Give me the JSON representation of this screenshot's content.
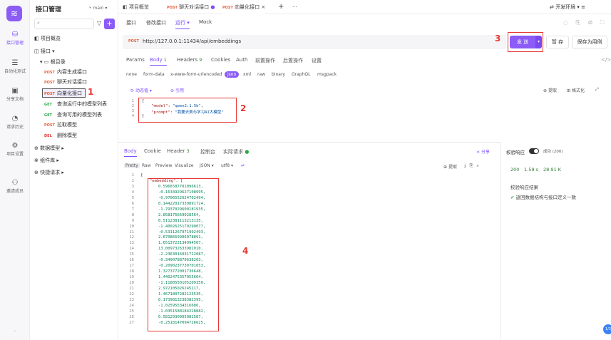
{
  "rail": {
    "items": [
      {
        "label": "接口管理",
        "icon": "api-icon"
      },
      {
        "label": "自动化测试",
        "icon": "automation-icon"
      },
      {
        "label": "分享文档",
        "icon": "doc-share-icon"
      },
      {
        "label": "请求历史",
        "icon": "history-icon"
      },
      {
        "label": "项目设置",
        "icon": "settings-icon"
      },
      {
        "label": "邀请成员",
        "icon": "invite-icon"
      }
    ]
  },
  "tree": {
    "title": "接口管理",
    "branch": "main",
    "search_placeholder": "",
    "overview": "项目概览",
    "api_group": "接口",
    "root": "根目录",
    "items": [
      {
        "method": "POST",
        "name": "内容生成接口"
      },
      {
        "method": "POST",
        "name": "聊天对话接口"
      },
      {
        "method": "POST",
        "name": "向量化接口"
      },
      {
        "method": "GET",
        "name": "查询运行中的模型列表"
      },
      {
        "method": "GET",
        "name": "查询可用的模型列表"
      },
      {
        "method": "POST",
        "name": "拉取模型"
      },
      {
        "method": "DEL",
        "name": "删除模型"
      }
    ],
    "data_models": "数据模型",
    "components": "组件库",
    "quick_requests": "快捷请求"
  },
  "annotations": {
    "a1": "1",
    "a2": "2",
    "a3": "3",
    "a4": "4"
  },
  "topbar": {
    "tabs": [
      {
        "method": "",
        "label": "项目概览"
      },
      {
        "method": "POST",
        "label": "聊天对话接口"
      },
      {
        "method": "POST",
        "label": "向量化接口"
      }
    ],
    "plus": "+",
    "more": "···",
    "env": "开发环境"
  },
  "subtabs": [
    "接口",
    "修改接口",
    "运行",
    "Mock"
  ],
  "url": {
    "method": "POST",
    "value": "http://127.0.0.1:11434/api/embeddings"
  },
  "actions": {
    "send": "发 送",
    "save": "暂 存",
    "save_case": "保存为用例"
  },
  "request_tabs": [
    "Params",
    "Body",
    "Headers",
    "Cookies",
    "Auth",
    "前置操作",
    "后置操作",
    "设置"
  ],
  "request_counts": {
    "body": "1",
    "headers": "9"
  },
  "body_types": [
    "none",
    "form-data",
    "x-www-form-urlencoded",
    "json",
    "xml",
    "raw",
    "binary",
    "GraphQL",
    "msgpack"
  ],
  "editor_tools": {
    "auto": "动态值",
    "vars": "引用",
    "extract": "提取",
    "format": "格式化"
  },
  "request_body": {
    "lines": [
      "{",
      "    \"model\": \"qwen2:1.5b\",",
      "    \"prompt\": \"我要去美与学习AI大模型\"",
      "}"
    ],
    "model_key": "\"model\"",
    "model_val": "\"qwen2:1.5b\"",
    "prompt_key": "\"prompt\"",
    "prompt_val": "\"我要去美与学习AI大模型\""
  },
  "response_tabs": [
    "Body",
    "Cookie",
    "Header",
    "控制台",
    "实际请求"
  ],
  "response_counts": {
    "header": "3"
  },
  "share": "分享",
  "response_views": [
    "Pretty",
    "Raw",
    "Preview",
    "Visualize",
    "JSON",
    "utf8"
  ],
  "response_extract": "提取",
  "response": {
    "key": "\"embedding\"",
    "values": [
      "0.5966587701096613,",
      "-0.1634929627108995,",
      "-0.9706552624702494,",
      "0.14422017339891724,",
      "-1.7937029600181935,",
      "2.858176669028564,",
      "0.5112381113213135,",
      "-1.4002625179290077,",
      "-0.5311267971992493,",
      "2.6708669906078891,",
      "1.6513723134994507,",
      "13.009732633981010,",
      "-2.2363016031712087,",
      "-0.349078870638203,",
      "-0.2090237730701053,",
      "1.3273772001736648,",
      "1.4402475357055664,",
      "-1.1180550105209350,",
      "2.972105026245117,",
      "1.4671807282123535,",
      "0.1739813238382395,",
      "-1.02595534316686,",
      "-1.0351588184228882,",
      "0.5812930905081587,",
      "-0.2518147094726625,"
    ]
  },
  "right_panel": {
    "validate_label": "校验响应",
    "status_label": "成功 (200)",
    "status": "200",
    "time": "1.59 s",
    "size": "28.91 K",
    "result_title": "校验响应结果",
    "result_text": "返回数据结构与接口定义一致"
  }
}
